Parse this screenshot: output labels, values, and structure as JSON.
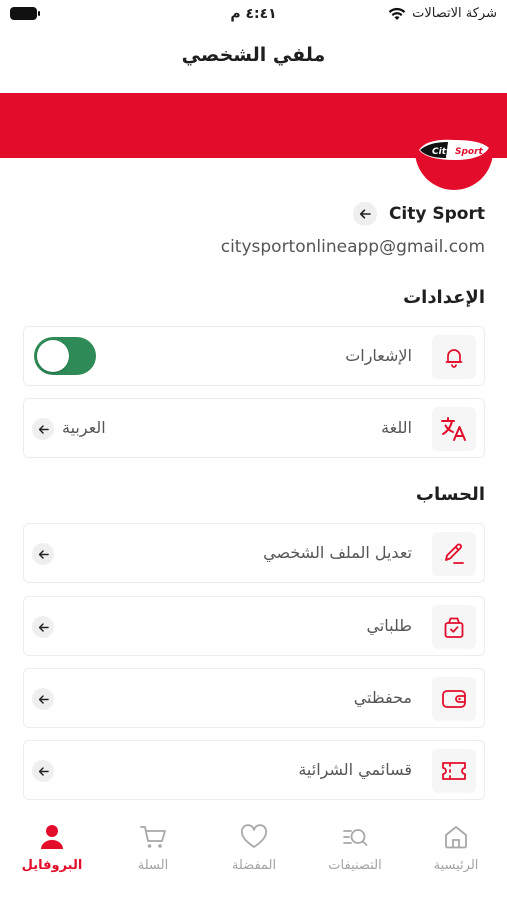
{
  "status_bar": {
    "time": "٤:٤١ م",
    "carrier": "شركة الاتصالات"
  },
  "header": {
    "title": "ملفي الشخصي"
  },
  "brand": {
    "accent": "#e30d2b",
    "toggle_on": "#2e8b57",
    "logo_text_left": "City",
    "logo_text_right": "Sport"
  },
  "profile": {
    "name": "City Sport",
    "email": "citysportonlineapp@gmail.com"
  },
  "settings": {
    "title": "الإعدادات",
    "notifications": {
      "label": "الإشعارات",
      "icon": "bell-icon",
      "enabled": true
    },
    "language": {
      "label": "اللغة",
      "value": "العربية",
      "icon": "translate-icon"
    }
  },
  "account": {
    "title": "الحساب",
    "items": [
      {
        "label": "تعديل الملف الشخصي",
        "icon": "edit-pencil-icon"
      },
      {
        "label": "طلباتي",
        "icon": "shopping-bag-icon"
      },
      {
        "label": "محفظتي",
        "icon": "wallet-icon"
      },
      {
        "label": "قسائمي الشرائية",
        "icon": "ticket-icon"
      }
    ]
  },
  "nav": {
    "items": [
      {
        "label": "الرئيسية",
        "icon": "home-icon",
        "active": false
      },
      {
        "label": "التصنيفات",
        "icon": "categories-search-icon",
        "active": false
      },
      {
        "label": "المفضلة",
        "icon": "heart-icon",
        "active": false
      },
      {
        "label": "السلة",
        "icon": "cart-icon",
        "active": false
      },
      {
        "label": "البروفايل",
        "icon": "profile-icon",
        "active": true
      }
    ]
  }
}
